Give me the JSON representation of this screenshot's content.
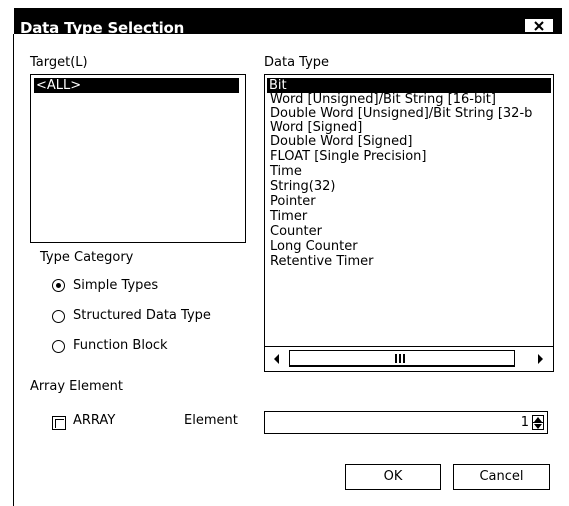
{
  "window": {
    "title": "Data Type Selection"
  },
  "target": {
    "label": "Target(L)",
    "items": [
      "<ALL>"
    ]
  },
  "data_type": {
    "label": "Data Type",
    "items": [
      "Bit",
      "Word [Unsigned]/Bit String [16-bit]",
      "Double Word [Unsigned]/Bit String [32-b",
      "Word [Signed]",
      "Double Word [Signed]",
      "FLOAT [Single Precision]",
      "Time",
      "String(32)",
      "Pointer",
      "Timer",
      "Counter",
      "Long Counter",
      "Retentive Timer"
    ]
  },
  "type_category": {
    "label": "Type Category",
    "options": [
      "Simple Types",
      "Structured Data Type",
      "Function Block"
    ],
    "selected": "Simple Types"
  },
  "array_element": {
    "label": "Array Element",
    "checkbox_label": "ARRAY",
    "element_label": "Element",
    "element_value": "1"
  },
  "buttons": {
    "ok": "OK",
    "cancel": "Cancel"
  },
  "icons": {
    "close": "close-icon",
    "scroll_left": "arrow-left-icon",
    "scroll_right": "arrow-right-icon",
    "thumb_grip": "grip-icon",
    "spin_up": "spin-up-icon",
    "spin_down": "spin-down-icon"
  }
}
